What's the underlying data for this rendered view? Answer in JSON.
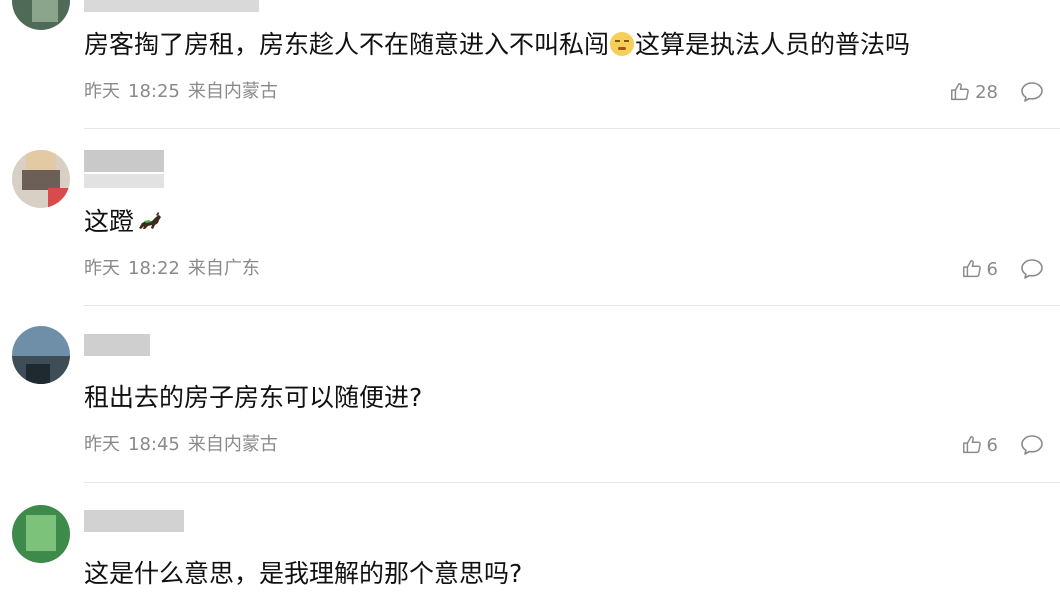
{
  "comments": [
    {
      "text": "房客掏了房租，房东趁人不在随意进入不叫私闯",
      "emoji": "face-emoji",
      "text_after": "这算是执法人员的普法吗",
      "date": "昨天",
      "time": "18:25",
      "location": "来自内蒙古",
      "likes": "28"
    },
    {
      "text": "这蹬",
      "emoji": "horse-emoji",
      "text_after": "",
      "date": "昨天",
      "time": "18:22",
      "location": "来自广东",
      "likes": "6"
    },
    {
      "text": "租出去的房子房东可以随便进?",
      "text_after": "",
      "date": "昨天",
      "time": "18:45",
      "location": "来自内蒙古",
      "likes": "6"
    },
    {
      "text": "这是什么意思，是我理解的那个意思吗?"
    }
  ],
  "icons": {
    "like": "thumbs-up-icon",
    "reply": "speech-bubble-icon"
  },
  "colors": {
    "meta": "#8a8a8a",
    "divider": "#e6e6e6",
    "text": "#111111"
  }
}
